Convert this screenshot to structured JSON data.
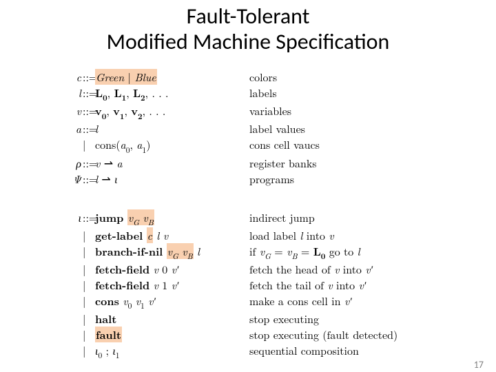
{
  "title_line1": "Fault-Tolerant",
  "title_line2": "Modified Machine Specification",
  "page_number": "17",
  "grammar1": [
    {
      "sym": "c",
      "def": "::=",
      "body_html": "<span class='hl'><span class='it'>Green</span> | <span class='it'>Blue</span></span>",
      "desc": "colors"
    },
    {
      "sym": "l",
      "def": "::=",
      "body_html": "<span class='b'>L<span class='sub'>0</span></span>, <span class='b'>L<span class='sub'>1</span></span>, <span class='b'>L<span class='sub'>2</span></span>, . . .",
      "desc": "labels"
    },
    {
      "sym": "v",
      "def": "::=",
      "body_html": "<span class='b'>v<span class='sub'>0</span></span>, <span class='b'>v<span class='sub'>1</span></span>, <span class='b'>v<span class='sub'>2</span></span>, . . .",
      "desc": "variables"
    },
    {
      "sym": "a",
      "def": "::=",
      "body_html": "<span class='it'>l</span>",
      "desc": "label values"
    },
    {
      "sym": "",
      "def": "|",
      "body_html": "cons(<span class='it'>a</span><span class='sub'>0</span>, <span class='it'>a</span><span class='sub'>1</span>)",
      "desc": "cons cell vaucs"
    },
    {
      "sym": "ρ",
      "def": "::=",
      "body_html": "<span class='it'>v</span> &#8640; <span class='it'>a</span>",
      "desc": "register banks"
    },
    {
      "sym": "Ψ",
      "def": "::=",
      "body_html": "<span class='it'>l</span> &#8640; <span class='it'>ι</span>",
      "desc": "programs"
    }
  ],
  "grammar2": [
    {
      "sym": "ι",
      "def": "::=",
      "body_html": "<span class='b'>jump</span> <span class='hl'><span class='it'>v<span class='sub'>G</span></span> <span class='it'>v<span class='sub'>B</span></span></span>",
      "desc": "indirect jump"
    },
    {
      "sym": "",
      "def": "|",
      "body_html": "<span class='b'>get-label</span> <span class='hl'><span class='it'>c</span></span> <span class='it'>l</span> <span class='it'>v</span>",
      "desc_html": "load label <span class='it'>l</span> into <span class='it'>v</span>"
    },
    {
      "sym": "",
      "def": "|",
      "body_html": "<span class='b'>branch-if-nil</span> <span class='hl'><span class='it'>v<span class='sub'>G</span></span> <span class='it'>v<span class='sub'>B</span></span></span> <span class='it'>l</span>",
      "desc_html": "if <span class='it'>v<span class='sub'>G</span></span> = <span class='it'>v<span class='sub'>B</span></span> = <span class='b'>L<span class='sub'>0</span></span> go to <span class='it'>l</span>"
    },
    {
      "sym": "",
      "def": "|",
      "body_html": "<span class='b'>fetch-field</span> <span class='it'>v</span> 0 <span class='it'>v&#8242;</span>",
      "desc_html": "fetch the head of <span class='it'>v</span> into <span class='it'>v&#8242;</span>"
    },
    {
      "sym": "",
      "def": "|",
      "body_html": "<span class='b'>fetch-field</span> <span class='it'>v</span> 1 <span class='it'>v&#8242;</span>",
      "desc_html": "fetch the tail of <span class='it'>v</span> into <span class='it'>v&#8242;</span>"
    },
    {
      "sym": "",
      "def": "|",
      "body_html": "<span class='b'>cons</span> <span class='it'>v</span><span class='sub'>0</span> <span class='it'>v</span><span class='sub'>1</span> <span class='it'>v&#8242;</span>",
      "desc_html": "make a cons cell in <span class='it'>v&#8242;</span>"
    },
    {
      "sym": "",
      "def": "|",
      "body_html": "<span class='b'>halt</span>",
      "desc": "stop executing"
    },
    {
      "sym": "",
      "def": "|",
      "body_html": "<span class='hl'><span class='b'>fault</span></span>",
      "desc": "stop executing (fault detected)"
    },
    {
      "sym": "",
      "def": "|",
      "body_html": "<span class='it'>ι</span><span class='sub'>0</span> ; <span class='it'>ι</span><span class='sub'>1</span>",
      "desc": "sequential composition"
    }
  ]
}
